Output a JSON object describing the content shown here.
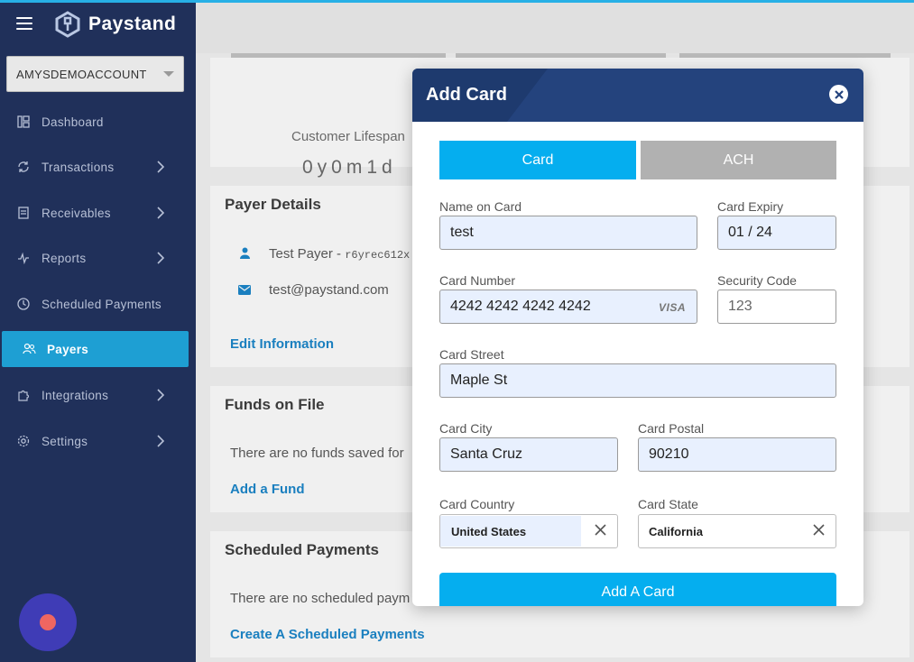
{
  "app": {
    "name": "Paystand"
  },
  "sidebar": {
    "account": "AMYSDEMOACCOUNT",
    "items": [
      {
        "label": "Dashboard",
        "icon": "dashboard-icon"
      },
      {
        "label": "Transactions",
        "icon": "sync-icon",
        "expandable": true
      },
      {
        "label": "Receivables",
        "icon": "document-icon",
        "expandable": true
      },
      {
        "label": "Reports",
        "icon": "pulse-icon",
        "expandable": true
      },
      {
        "label": "Scheduled Payments",
        "icon": "clock-icon"
      },
      {
        "label": "Payers",
        "icon": "users-icon",
        "active": true
      },
      {
        "label": "Integrations",
        "icon": "puzzle-icon",
        "expandable": true
      },
      {
        "label": "Settings",
        "icon": "gear-icon",
        "expandable": true
      }
    ]
  },
  "main": {
    "lifespan": {
      "label": "Customer Lifespan",
      "value": "0y0m1d"
    },
    "payer_details": {
      "title": "Payer Details",
      "name": "Test Payer - ",
      "id": "r6yrec612x",
      "email": "test@paystand.com",
      "edit_link": "Edit Information"
    },
    "funds": {
      "title": "Funds on File",
      "empty": "There are no funds saved for",
      "add_link": "Add a Fund"
    },
    "scheduled": {
      "title": "Scheduled Payments",
      "empty": "There are no scheduled paym",
      "create_link": "Create A Scheduled Payments"
    }
  },
  "modal": {
    "title": "Add Card",
    "tabs": {
      "card": "Card",
      "ach": "ACH"
    },
    "fields": {
      "name_label": "Name on Card",
      "name_value": "test",
      "expiry_label": "Card Expiry",
      "expiry_value": "01 / 24",
      "number_label": "Card Number",
      "number_value": "4242 4242 4242 4242",
      "card_brand": "VISA",
      "cvc_label": "Security Code",
      "cvc_placeholder": "123",
      "street_label": "Card Street",
      "street_value": "Maple St",
      "city_label": "Card City",
      "city_value": "Santa Cruz",
      "postal_label": "Card Postal",
      "postal_value": "90210",
      "country_label": "Card Country",
      "country_value": "United States",
      "state_label": "Card State",
      "state_value": "California"
    },
    "submit": "Add A Card"
  },
  "colors": {
    "sidebar_bg": "#20305a",
    "accent": "#05aeef",
    "modal_header": "#24437d",
    "fab": "#3f3cb6"
  }
}
